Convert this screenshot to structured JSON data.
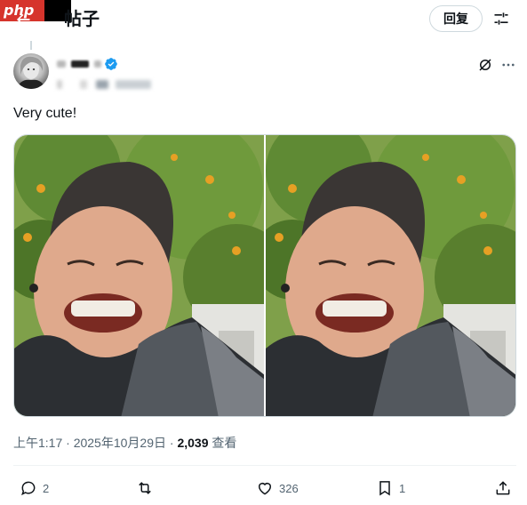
{
  "header": {
    "watermark": "php",
    "title": "帖子",
    "reply_button": "回复"
  },
  "post": {
    "text": "Very cute!",
    "time": "上午1:17",
    "date": "2025年10月29日",
    "views_count": "2,039",
    "views_label": "查看",
    "separator": "·"
  },
  "actions": {
    "replies": "2",
    "likes": "326",
    "bookmarks": "1"
  },
  "colors": {
    "verified": "#1d9bf0",
    "text_secondary": "#536471",
    "border": "#cfd9de"
  },
  "icons": [
    "back-arrow-icon",
    "filter-icon",
    "verified-badge-icon",
    "grok-icon",
    "more-icon",
    "reply-icon",
    "retweet-icon",
    "like-icon",
    "bookmark-icon",
    "share-icon"
  ]
}
